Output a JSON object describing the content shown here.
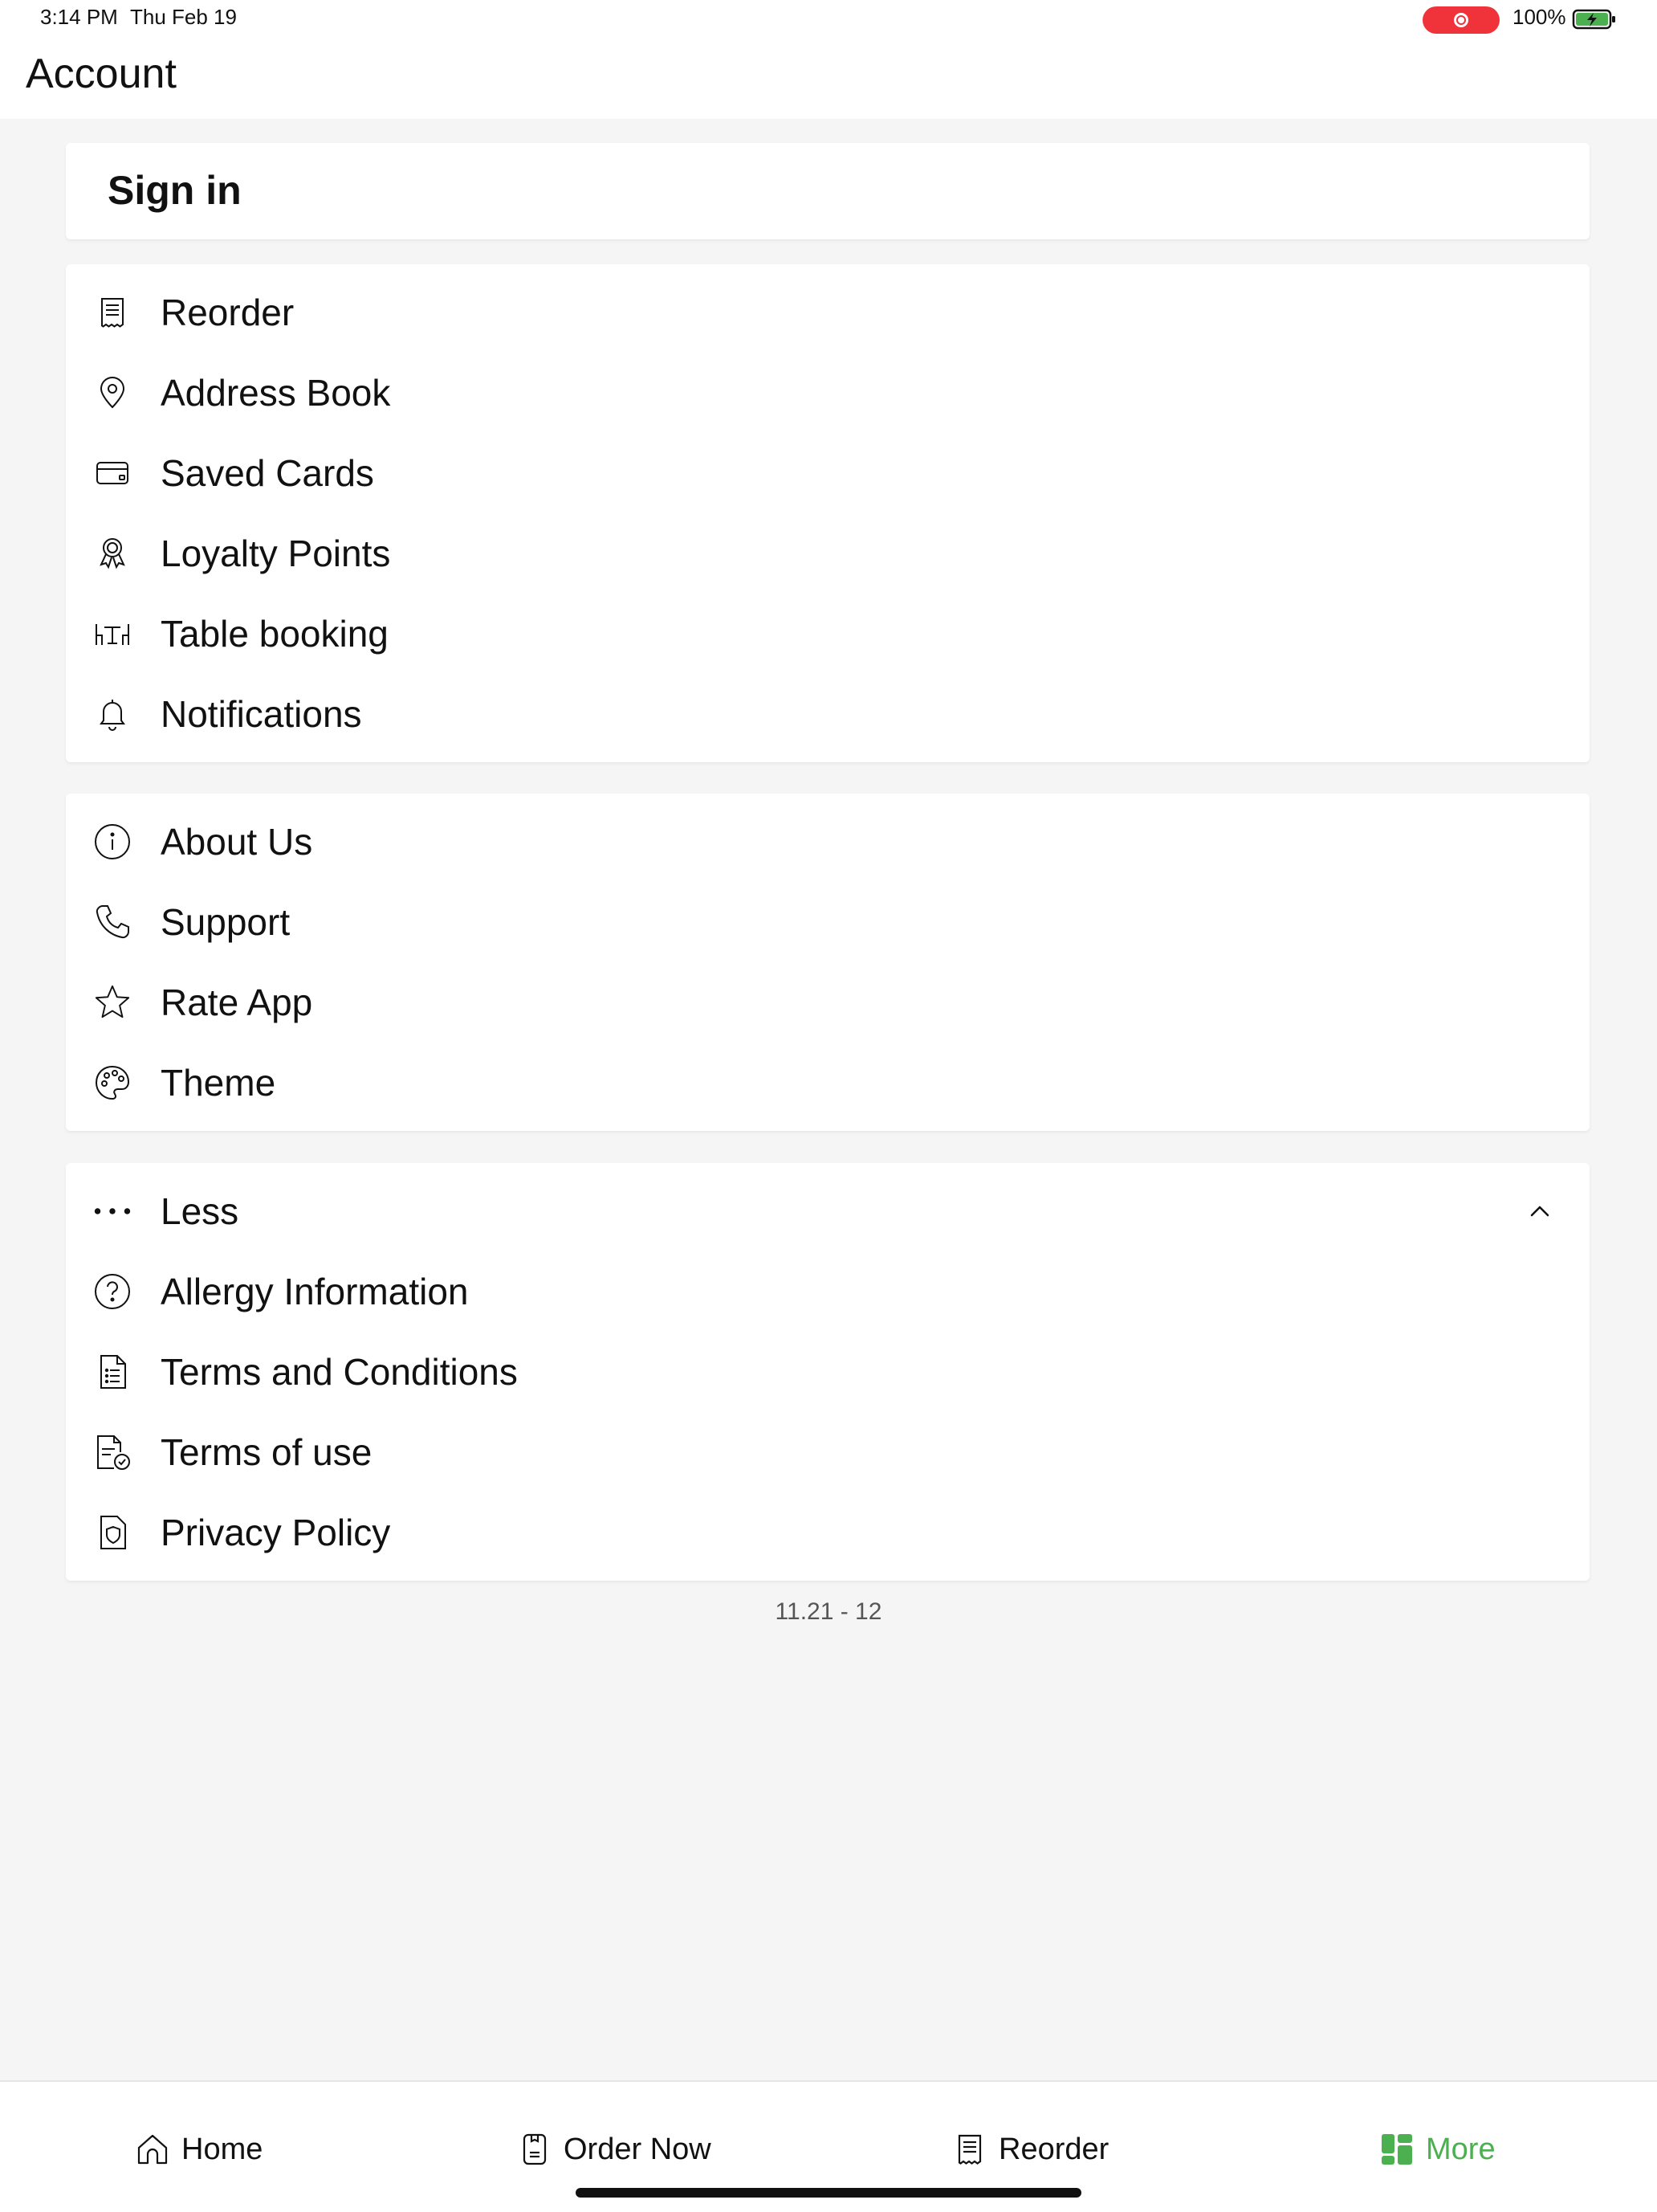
{
  "status_bar": {
    "time": "3:14 PM",
    "date": "Thu Feb 19",
    "battery_percent": "100%",
    "recording_color": "#f0333a",
    "battery_color": "#4caf50"
  },
  "header": {
    "title": "Account"
  },
  "sign_in": {
    "label": "Sign in"
  },
  "account_items": [
    {
      "label": "Reorder",
      "icon": "receipt-icon"
    },
    {
      "label": "Address Book",
      "icon": "map-pin-icon"
    },
    {
      "label": "Saved Cards",
      "icon": "credit-card-icon"
    },
    {
      "label": "Loyalty Points",
      "icon": "award-ribbon-icon"
    },
    {
      "label": "Table booking",
      "icon": "table-chairs-icon"
    },
    {
      "label": "Notifications",
      "icon": "bell-icon"
    }
  ],
  "info_items": [
    {
      "label": "About Us",
      "icon": "info-circle-icon"
    },
    {
      "label": "Support",
      "icon": "phone-icon"
    },
    {
      "label": "Rate App",
      "icon": "star-icon"
    },
    {
      "label": "Theme",
      "icon": "palette-icon"
    }
  ],
  "more_section": {
    "toggle_label": "Less",
    "toggle_icon": "more-dots-icon",
    "expanded": true,
    "items": [
      {
        "label": "Allergy Information",
        "icon": "question-circle-icon"
      },
      {
        "label": "Terms and Conditions",
        "icon": "document-list-icon"
      },
      {
        "label": "Terms of use",
        "icon": "document-check-icon"
      },
      {
        "label": "Privacy Policy",
        "icon": "shield-document-icon"
      }
    ]
  },
  "version": "11.21 - 12",
  "tab_bar": {
    "active_color": "#4caf50",
    "tabs": [
      {
        "label": "Home",
        "icon": "home-icon",
        "active": false
      },
      {
        "label": "Order Now",
        "icon": "order-icon",
        "active": false
      },
      {
        "label": "Reorder",
        "icon": "receipt-icon",
        "active": false
      },
      {
        "label": "More",
        "icon": "grid-icon",
        "active": true
      }
    ]
  }
}
